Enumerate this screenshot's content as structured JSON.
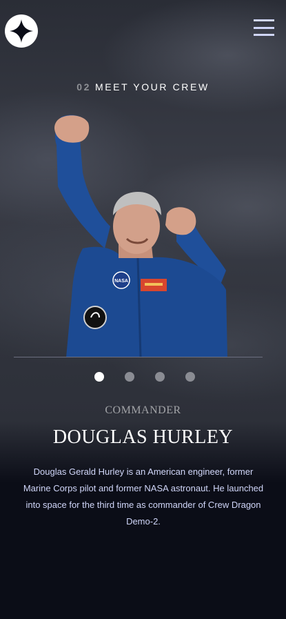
{
  "header": {
    "logo_icon": "star-logo-icon",
    "menu_icon": "hamburger-menu-icon"
  },
  "section": {
    "number": "02",
    "title": "Meet your crew"
  },
  "crew": {
    "active_index": 0,
    "count": 4,
    "role": "Commander",
    "name": "Douglas Hurley",
    "bio": "Douglas Gerald Hurley is an American engineer, former Marine Corps pilot and former NASA astronaut. He launched into space for the third time as commander of Crew Dragon Demo-2.",
    "patch_text": "NASA"
  },
  "colors": {
    "background": "#0b0d17",
    "accent_light": "#d0d6f9",
    "dot_inactive": "#8a8c93",
    "dot_active": "#ffffff"
  }
}
